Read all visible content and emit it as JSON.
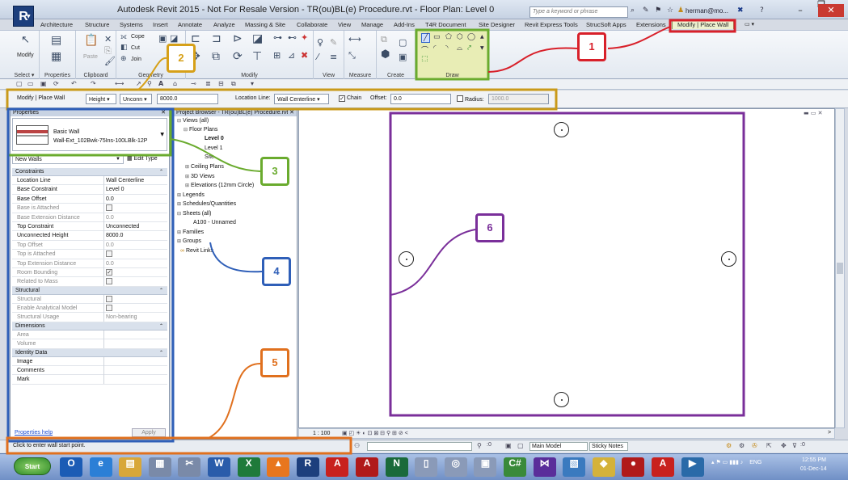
{
  "app": {
    "logo_letter": "R",
    "window_title": "Autodesk Revit 2015 - Not For Resale Version -    TR(ou)BL(e) Procedure.rvt - Floor Plan: Level 0",
    "search_placeholder": "Type a keyword or phrase",
    "user": "herman@mo...",
    "win_min": "–",
    "win_restore": "❐",
    "win_close": "✕"
  },
  "ribbon_tabs": [
    "Architecture",
    "Structure",
    "Systems",
    "Insert",
    "Annotate",
    "Analyze",
    "Massing & Site",
    "Collaborate",
    "View",
    "Manage",
    "Add-Ins",
    "T4R Document",
    "Site Designer",
    "Revit Express Tools",
    "StrucSoft Apps",
    "Extensions",
    "Modify | Place Wall"
  ],
  "ribbon": {
    "modify_label": "Modify",
    "paste_label": "Paste",
    "cope_label": "Cope",
    "cut_label": "Cut",
    "join_label": "Join",
    "panels": {
      "select": "Select ▾",
      "properties": "Properties",
      "clipboard": "Clipboard",
      "geometry": "Geometry",
      "modify": "Modify",
      "view": "View",
      "measure": "Measure",
      "create": "Create",
      "draw": "Draw"
    }
  },
  "options_bar": {
    "context": "Modify | Place Wall",
    "height_mode": "Height",
    "top_constraint": "Unconn",
    "height_value": "8000.0",
    "location_line_label": "Location Line:",
    "location_line_value": "Wall Centerline",
    "chain_label": "Chain",
    "chain_checked": "✓",
    "offset_label": "Offset:",
    "offset_value": "0.0",
    "radius_label": "Radius:",
    "radius_value": "1000.0"
  },
  "properties": {
    "header": "Properties",
    "close": "✕",
    "type_family": "Basic Wall",
    "type_name": "Wall-Ext_102Bwk-75Ins-100LBlk-12P",
    "instance_filter": "New Walls",
    "edit_type": "Edit Type",
    "categories": [
      {
        "name": "Constraints",
        "rows": [
          {
            "name": "Location Line",
            "value": "Wall Centerline",
            "check": false,
            "disabled": false
          },
          {
            "name": "Base Constraint",
            "value": "Level 0",
            "check": false,
            "disabled": false
          },
          {
            "name": "Base Offset",
            "value": "0.0",
            "check": false,
            "disabled": false
          },
          {
            "name": "Base is Attached",
            "value": "",
            "check": true,
            "disabled": true
          },
          {
            "name": "Base Extension Distance",
            "value": "0.0",
            "check": false,
            "disabled": true
          },
          {
            "name": "Top Constraint",
            "value": "Unconnected",
            "check": false,
            "disabled": false
          },
          {
            "name": "Unconnected Height",
            "value": "8000.0",
            "check": false,
            "disabled": false
          },
          {
            "name": "Top Offset",
            "value": "0.0",
            "check": false,
            "disabled": true
          },
          {
            "name": "Top is Attached",
            "value": "",
            "check": true,
            "disabled": true
          },
          {
            "name": "Top Extension Distance",
            "value": "0.0",
            "check": false,
            "disabled": true
          },
          {
            "name": "Room Bounding",
            "value": "✓",
            "check": true,
            "disabled": true
          },
          {
            "name": "Related to Mass",
            "value": "",
            "check": true,
            "disabled": true
          }
        ]
      },
      {
        "name": "Structural",
        "rows": [
          {
            "name": "Structural",
            "value": "",
            "check": true,
            "disabled": true
          },
          {
            "name": "Enable Analytical Model",
            "value": "",
            "check": true,
            "disabled": true
          },
          {
            "name": "Structural Usage",
            "value": "Non-bearing",
            "check": false,
            "disabled": true
          }
        ]
      },
      {
        "name": "Dimensions",
        "rows": [
          {
            "name": "Area",
            "value": "",
            "check": false,
            "disabled": true
          },
          {
            "name": "Volume",
            "value": "",
            "check": false,
            "disabled": true
          }
        ]
      },
      {
        "name": "Identity Data",
        "rows": [
          {
            "name": "Image",
            "value": "",
            "check": false,
            "disabled": false
          },
          {
            "name": "Comments",
            "value": "",
            "check": false,
            "disabled": false
          },
          {
            "name": "Mark",
            "value": "",
            "check": false,
            "disabled": false
          }
        ]
      }
    ],
    "help": "Properties help",
    "apply": "Apply"
  },
  "project_browser": {
    "header": "Project Browser - TR(ou)BL(e) Procedure.rvt",
    "close": "✕",
    "items": [
      {
        "label": "Views (all)",
        "toggle": "⊟",
        "bold": false
      },
      {
        "label": "Floor Plans",
        "toggle": "⊟",
        "bold": false
      },
      {
        "label": "Level 0",
        "toggle": "",
        "bold": true
      },
      {
        "label": "Level 1",
        "toggle": "",
        "bold": false
      },
      {
        "label": "Site",
        "toggle": "",
        "bold": false
      },
      {
        "label": "Ceiling Plans",
        "toggle": "⊞",
        "bold": false
      },
      {
        "label": "3D Views",
        "toggle": "⊞",
        "bold": false
      },
      {
        "label": "Elevations (12mm Circle)",
        "toggle": "⊞",
        "bold": false
      },
      {
        "label": "Legends",
        "toggle": "⊞",
        "bold": false
      },
      {
        "label": "Schedules/Quantities",
        "toggle": "⊞",
        "bold": false
      },
      {
        "label": "Sheets (all)",
        "toggle": "⊟",
        "bold": false
      },
      {
        "label": "A100 - Unnamed",
        "toggle": "",
        "bold": false
      },
      {
        "label": "Families",
        "toggle": "⊞",
        "bold": false
      },
      {
        "label": "Groups",
        "toggle": "⊞",
        "bold": false
      },
      {
        "label": "Revit Links",
        "toggle": "",
        "bold": false
      }
    ]
  },
  "view": {
    "scale": "1 : 100",
    "view_controls": "▣ ◰ ☀ ◐ ⊡ ⊠ ⊟ ⚲ ⊞ ⊘ <",
    "scroll_right": ">",
    "window_controls": "▬ ▭ ✕"
  },
  "statusbar": {
    "message": "Click to enter wall start point.",
    "worksets_count": ":0",
    "model": "Main Model",
    "sticky": "Sticky Notes",
    "filter_count": ":0"
  },
  "taskbar": {
    "start": "Start",
    "apps": [
      {
        "label": "O",
        "color": "#1b5cb5"
      },
      {
        "label": "e",
        "color": "#2b7fd6"
      },
      {
        "label": "▤",
        "color": "#d8a73a"
      },
      {
        "label": "▦",
        "color": "#7a8aa8"
      },
      {
        "label": "✂",
        "color": "#7a8aa8"
      },
      {
        "label": "W",
        "color": "#2a5caa"
      },
      {
        "label": "X",
        "color": "#1f7a3a"
      },
      {
        "label": "▲",
        "color": "#e8761e"
      },
      {
        "label": "R",
        "color": "#1d3f7d"
      },
      {
        "label": "A",
        "color": "#c8211e"
      },
      {
        "label": "A",
        "color": "#b01a1a"
      },
      {
        "label": "N",
        "color": "#1a6a3a"
      },
      {
        "label": "▯",
        "color": "#8a9ab8"
      },
      {
        "label": "◎",
        "color": "#8a9ab8"
      },
      {
        "label": "▣",
        "color": "#8a9ab8"
      },
      {
        "label": "C#",
        "color": "#3a8a3a"
      },
      {
        "label": "⋈",
        "color": "#5a2e9a"
      },
      {
        "label": "▧",
        "color": "#3a7abf"
      },
      {
        "label": "◆",
        "color": "#d4b23a"
      },
      {
        "label": "●",
        "color": "#b01a1a"
      },
      {
        "label": "A",
        "color": "#c8211e"
      },
      {
        "label": "▶",
        "color": "#2a6aa8"
      }
    ],
    "tray_lang": "ENG",
    "time": "12:55 PM",
    "date": "01-Dec-14"
  },
  "annotations": [
    {
      "id": "callout-1",
      "label": "1",
      "color": "#d8202a"
    },
    {
      "id": "callout-2",
      "label": "2",
      "color": "#d6a018"
    },
    {
      "id": "callout-3",
      "label": "3",
      "color": "#6aab2e"
    },
    {
      "id": "callout-4",
      "label": "4",
      "color": "#2f5fb8"
    },
    {
      "id": "callout-5",
      "label": "5",
      "color": "#e0701e"
    },
    {
      "id": "callout-6",
      "label": "6",
      "color": "#7a2f9a"
    }
  ]
}
